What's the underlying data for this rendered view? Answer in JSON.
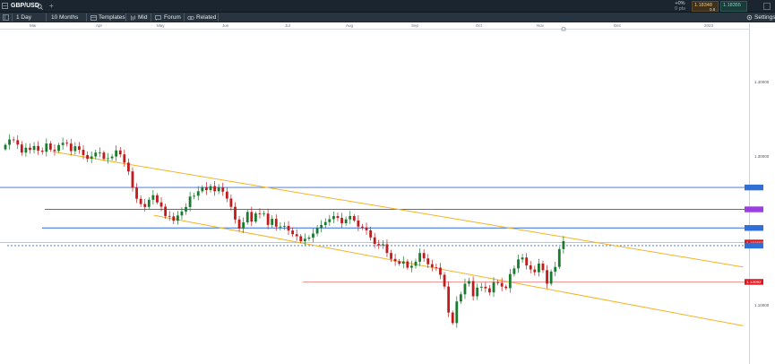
{
  "header": {
    "symbol": "GBP/USD",
    "add_symbol": "+",
    "change_pct": "+0%",
    "change_pips": "0 pts",
    "sell_price": "1.18348",
    "buy_price": "1.18355",
    "spread": "0.8"
  },
  "toolbar": {
    "interval": "1 Day",
    "range": "10 Months",
    "templates": "Templates",
    "mid": "Mid",
    "forum": "Forum",
    "related": "Related",
    "settings": "Settings"
  },
  "time_axis": {
    "months": [
      "Mar",
      "Apr",
      "May",
      "Jun",
      "Jul",
      "Aug",
      "Sep",
      "Oct",
      "Nov",
      "Dec",
      "2023"
    ]
  },
  "price_axis": {
    "labels": [
      "1.40000",
      "1.30000",
      "1.10000"
    ],
    "tags": [
      "",
      "",
      "",
      "1.183686",
      "1.13082"
    ]
  },
  "colors": {
    "toolbar_bg": "#28343f",
    "topbar_bg": "#1a2530",
    "up_candle": "#1a7a2e",
    "down_candle": "#c11b1b",
    "channel_line": "#f5b324",
    "blue_level": "#2f6fd6",
    "purple_level": "#9b3fe0",
    "red_level": "#f08a8a",
    "current_price_tag": "#e0141e"
  },
  "chart_data": {
    "type": "candlestick",
    "symbol": "GBP/USD",
    "interval": "1 Day",
    "range": "10 Months",
    "ylim": [
      1.045,
      1.45
    ],
    "y_ticks": [
      1.4,
      1.3,
      1.1
    ],
    "horizontal_levels": [
      {
        "value": 1.2577,
        "color": "blue"
      },
      {
        "value": 1.2283,
        "color": "purple"
      },
      {
        "value": 1.2033,
        "color": "blue"
      },
      {
        "value": 1.1837,
        "color": "gray",
        "label": "1.183686"
      },
      {
        "value": 1.1796,
        "color": "blue",
        "style": "dashed"
      },
      {
        "value": 1.1308,
        "color": "red",
        "label": "1.13082"
      }
    ],
    "trendlines": [
      {
        "color": "orange",
        "points": [
          [
            0.07,
            1.3059
          ],
          [
            0.99,
            1.1508
          ]
        ]
      },
      {
        "color": "orange",
        "points": [
          [
            0.205,
            1.2203
          ],
          [
            0.99,
            1.0718
          ]
        ]
      }
    ],
    "closes": [
      1.315,
      1.3222,
      1.3212,
      1.3154,
      1.3046,
      1.3112,
      1.3082,
      1.3134,
      1.3072,
      1.3057,
      1.3168,
      1.3086,
      1.3068,
      1.3147,
      1.3178,
      1.3167,
      1.3066,
      1.3131,
      1.3084,
      1.3012,
      1.2963,
      1.2994,
      1.3046,
      1.3047,
      1.2962,
      1.297,
      1.2993,
      1.3075,
      1.3022,
      1.2911,
      1.2793,
      1.2572,
      1.2425,
      1.2355,
      1.2316,
      1.2412,
      1.2473,
      1.2376,
      1.2319,
      1.2194,
      1.2189,
      1.213,
      1.2201,
      1.2254,
      1.2314,
      1.2455,
      1.2466,
      1.2526,
      1.258,
      1.2542,
      1.2595,
      1.2527,
      1.2579,
      1.2521,
      1.2428,
      1.2317,
      1.2147,
      1.2025,
      1.2108,
      1.2248,
      1.2119,
      1.2228,
      1.2223,
      1.2226,
      1.2074,
      1.2155,
      1.2051,
      1.2052,
      1.2061,
      1.1998,
      1.1949,
      1.1922,
      1.1855,
      1.1888,
      1.1904,
      1.1958,
      1.2032,
      1.2072,
      1.2112,
      1.2152,
      1.2192,
      1.2168,
      1.2097,
      1.2149,
      1.2193,
      1.2133,
      1.2052,
      1.2039,
      1.2002,
      1.1906,
      1.1818,
      1.18,
      1.1814,
      1.1697,
      1.1617,
      1.1585,
      1.1553,
      1.1584,
      1.1499,
      1.1525,
      1.158,
      1.1696,
      1.1624,
      1.1546,
      1.1505,
      1.1499,
      1.1404,
      1.1246,
      1.0896,
      1.0755,
      1.1045,
      1.1141,
      1.1284,
      1.1319,
      1.1115,
      1.1231,
      1.1243,
      1.1222,
      1.1167,
      1.1303,
      1.1293,
      1.1245,
      1.1224,
      1.1414,
      1.1489,
      1.161,
      1.1636,
      1.153,
      1.1475,
      1.1438,
      1.1554,
      1.1466,
      1.1284,
      1.1447,
      1.1509,
      1.1749,
      1.1856
    ]
  }
}
